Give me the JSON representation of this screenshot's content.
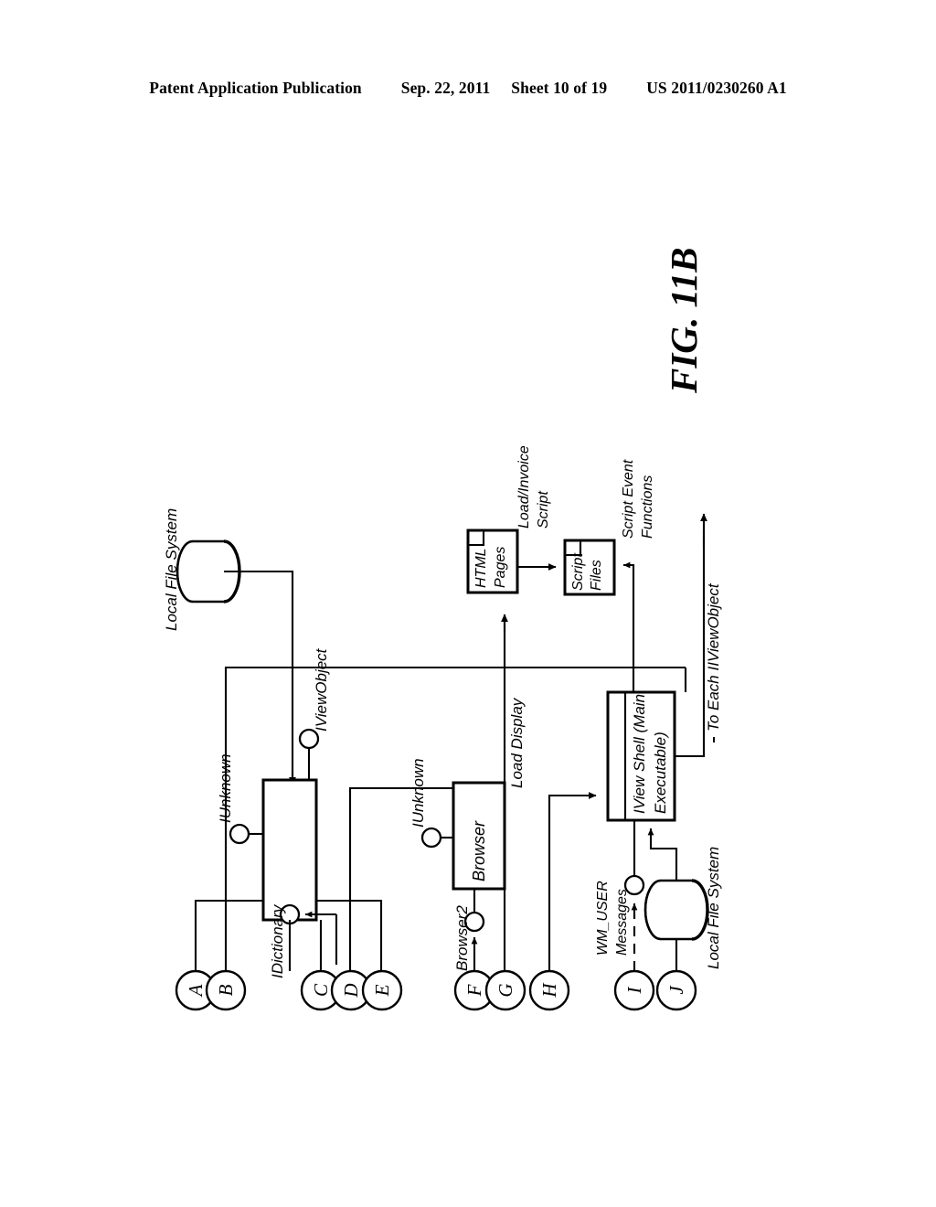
{
  "header": {
    "publication": "Patent Application Publication",
    "date": "Sep. 22, 2011",
    "sheet": "Sheet 10 of 19",
    "number": "US 2011/0230260 A1"
  },
  "figure": {
    "label": "FIG. 11B",
    "nodes": {
      "local_file_system_top": "Local File System",
      "local_file_system_bottom": "Local File System",
      "html_pages": "HTML Pages",
      "script_files": "Script Files",
      "browser": "Browser",
      "iview_shell": "IView Shell (Main Executable)",
      "unnamed_object": ""
    },
    "interfaces": {
      "iunknown_object": "IUnknown",
      "iviewobject": "IViewObject",
      "idictionary": "IDictionary",
      "iunknown_browser": "IUnknown",
      "browser2": "Browser2"
    },
    "edge_labels": {
      "load_invoice_script": "Load/Invoice Script",
      "script_event_functions": "Script Event Functions",
      "load_display": "Load Display",
      "to_each_iiviewobject": "To Each IIViewObject",
      "wm_user_messages": "WM_USER Messages"
    },
    "connectors": [
      {
        "id": "A",
        "label": "A"
      },
      {
        "id": "B",
        "label": "B"
      },
      {
        "id": "C",
        "label": "C"
      },
      {
        "id": "D",
        "label": "D"
      },
      {
        "id": "E",
        "label": "E"
      },
      {
        "id": "F",
        "label": "F"
      },
      {
        "id": "G",
        "label": "G"
      },
      {
        "id": "H",
        "label": "H"
      },
      {
        "id": "I",
        "label": "I"
      },
      {
        "id": "J",
        "label": "J"
      }
    ]
  },
  "colors": {
    "ink": "#000000",
    "paper": "#ffffff"
  }
}
